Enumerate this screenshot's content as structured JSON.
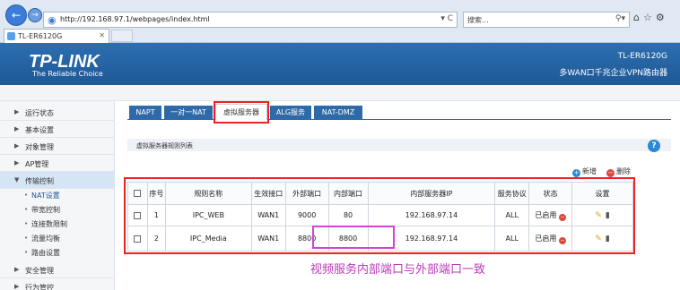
{
  "browser": {
    "url": "http://192.168.97.1/webpages/index.html",
    "url_controls": "▾ C",
    "search_placeholder": "搜索...",
    "tab_title": "TL-ER6120G"
  },
  "header": {
    "logo": "TP-LINK",
    "tagline": "The Reliable Choice",
    "model": "TL-ER6120G",
    "model_desc": "多WAN口千兆企业VPN路由器"
  },
  "sidebar": {
    "items": [
      {
        "label": "运行状态"
      },
      {
        "label": "基本设置"
      },
      {
        "label": "对象管理"
      },
      {
        "label": "AP管理"
      },
      {
        "label": "传输控制"
      },
      {
        "label": "安全管理"
      },
      {
        "label": "行为管控"
      }
    ],
    "subitems": [
      {
        "label": "NAT设置"
      },
      {
        "label": "带宽控制"
      },
      {
        "label": "连接数限制"
      },
      {
        "label": "流量均衡"
      },
      {
        "label": "路由设置"
      }
    ]
  },
  "tabs": [
    "NAPT",
    "一对一NAT",
    "虚拟服务器",
    "ALG服务",
    "NAT-DMZ"
  ],
  "panel": {
    "title": "虚拟服务器规则列表",
    "add_label": "新增",
    "delete_label": "删除"
  },
  "table": {
    "headers": [
      "序号",
      "规则名称",
      "生效接口",
      "外部端口",
      "内部端口",
      "内部服务器IP",
      "服务协议",
      "状态",
      "设置"
    ],
    "rows": [
      {
        "no": "1",
        "name": "IPC_WEB",
        "iface": "WAN1",
        "ext_port": "9000",
        "int_port": "80",
        "ip": "192.168.97.14",
        "proto": "ALL",
        "status": "已启用"
      },
      {
        "no": "2",
        "name": "IPC_Media",
        "iface": "WAN1",
        "ext_port": "8800",
        "int_port": "8800",
        "ip": "192.168.97.14",
        "proto": "ALL",
        "status": "已启用"
      }
    ]
  },
  "annotation": {
    "note": "视频服务内部端口与外部端口一致",
    "colors": {
      "red": "#e22222",
      "purple": "#d542d5"
    }
  }
}
